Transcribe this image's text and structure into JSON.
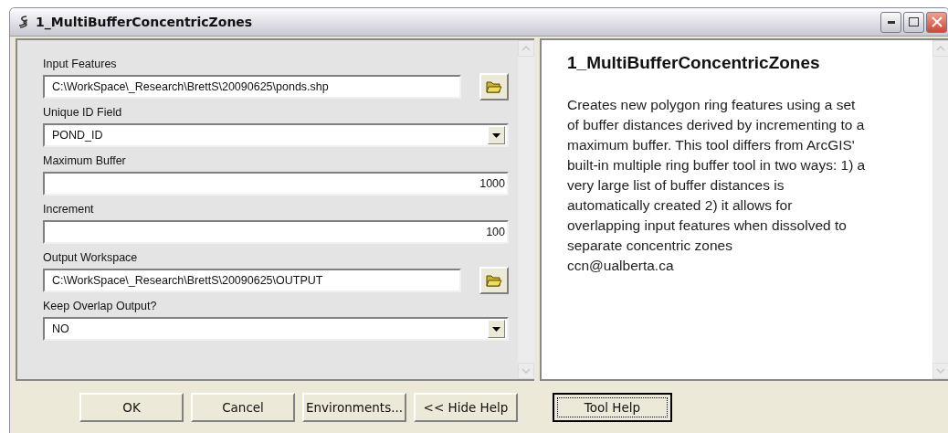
{
  "window": {
    "title": "1_MultiBufferConcentricZones"
  },
  "parameters": [
    {
      "kind": "path",
      "label": "Input Features",
      "value": "C:\\WorkSpace\\_Research\\BrettS\\20090625\\ponds.shp"
    },
    {
      "kind": "dropdown",
      "label": "Unique ID Field",
      "value": "POND_ID"
    },
    {
      "kind": "number",
      "label": "Maximum Buffer",
      "value": "1000"
    },
    {
      "kind": "number",
      "label": "Increment",
      "value": "100"
    },
    {
      "kind": "path",
      "label": "Output Workspace",
      "value": "C:\\WorkSpace\\_Research\\BrettS\\20090625\\OUTPUT"
    },
    {
      "kind": "dropdown",
      "label": "Keep Overlap Output?",
      "value": "NO"
    }
  ],
  "help": {
    "title": "1_MultiBufferConcentricZones",
    "body": "Creates new polygon ring features using a set of buffer distances derived by incrementing to a maximum buffer. This tool differs from ArcGIS' built-in multiple ring buffer tool in two ways: 1) a very large list of buffer distances is automatically created 2) it allows for overlapping input features when dissolved to separate concentric zones",
    "contact": "ccn@ualberta.ca"
  },
  "buttons": [
    {
      "label": "OK",
      "focused": false
    },
    {
      "label": "Cancel",
      "focused": false
    },
    {
      "label": "Environments...",
      "focused": false
    },
    {
      "label": "<< Hide Help",
      "focused": false
    },
    {
      "label": "Tool Help",
      "focused": true
    }
  ]
}
